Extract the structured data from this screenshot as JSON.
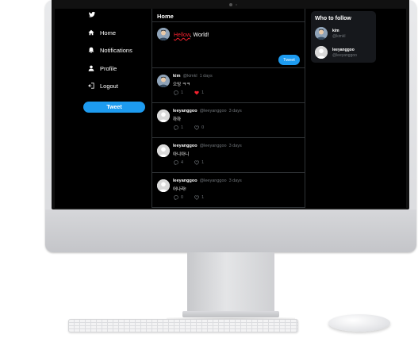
{
  "colors": {
    "accent": "#1d9bf0",
    "background": "#000000",
    "border": "#2f3336",
    "muted": "#71767b",
    "like": "#f4212e",
    "panel": "#16181c"
  },
  "sidebar": {
    "logo_icon": "twitter-bird-icon",
    "items": [
      {
        "label": "Home",
        "icon": "home-icon"
      },
      {
        "label": "Notifications",
        "icon": "bell-icon"
      },
      {
        "label": "Profile",
        "icon": "person-icon"
      },
      {
        "label": "Logout",
        "icon": "logout-icon"
      }
    ],
    "tweet_label": "Tweet"
  },
  "main": {
    "title": "Home",
    "compose": {
      "text_highlight": "Hellow",
      "text_rest": ", World!",
      "button_label": "Tweet"
    },
    "posts": [
      {
        "name": "kim",
        "handle": "@kimkl",
        "time": "1 days",
        "body": "으잉 ㅋㅋ",
        "comments": "1",
        "likes": "1",
        "liked": true
      },
      {
        "name": "leeyanggoo",
        "handle": "@leeyanggoo",
        "time": "3 days",
        "body": "하하",
        "comments": "1",
        "likes": "0",
        "liked": false
      },
      {
        "name": "leeyanggoo",
        "handle": "@leeyanggoo",
        "time": "3 days",
        "body": "아니아니",
        "comments": "4",
        "likes": "1",
        "liked": false
      },
      {
        "name": "leeyanggoo",
        "handle": "@leeyanggoo",
        "time": "3 days",
        "body": "어나라!",
        "comments": "0",
        "likes": "1",
        "liked": false
      }
    ]
  },
  "who_to_follow": {
    "title": "Who to follow",
    "users": [
      {
        "name": "kim",
        "handle": "@kimkl"
      },
      {
        "name": "leeyanggoo",
        "handle": "@leeyanggoo"
      }
    ]
  }
}
